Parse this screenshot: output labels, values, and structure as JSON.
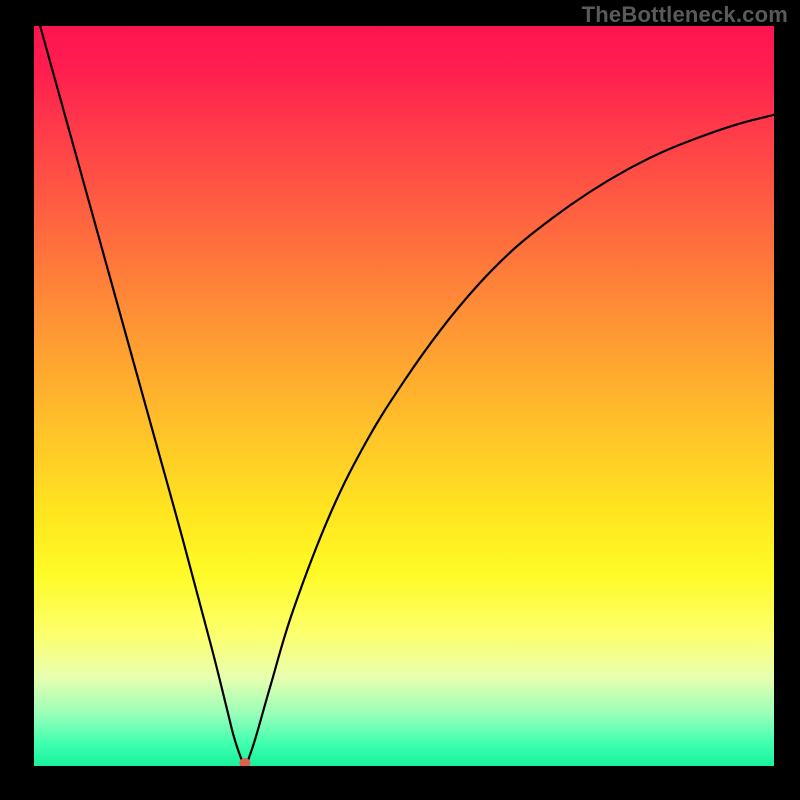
{
  "watermark": "TheBottleneck.com",
  "colors": {
    "frame": "#000000",
    "curve": "#000000",
    "dip_dot": "#e0604f"
  },
  "chart_data": {
    "type": "line",
    "title": "",
    "xlabel": "",
    "ylabel": "",
    "xlim": [
      0,
      100
    ],
    "ylim": [
      0,
      100
    ],
    "grid": false,
    "legend": false,
    "x": [
      0,
      5,
      10,
      15,
      20,
      24,
      26,
      27,
      28,
      28.5,
      29,
      30,
      32,
      35,
      40,
      45,
      50,
      55,
      60,
      65,
      70,
      75,
      80,
      85,
      90,
      95,
      100
    ],
    "y": [
      103,
      85,
      67,
      49,
      31,
      16,
      8,
      4,
      1,
      0,
      1,
      4,
      11,
      21,
      34,
      44,
      52,
      59,
      65,
      70,
      74,
      77.5,
      80.5,
      83,
      85,
      86.7,
      88
    ],
    "annotations": [
      {
        "type": "dot",
        "x": 28.5,
        "y": 0,
        "color": "#e0604f"
      }
    ],
    "background_gradient_stops": [
      {
        "pos": 0.0,
        "color": "#ff1450"
      },
      {
        "pos": 0.28,
        "color": "#ff6a3e"
      },
      {
        "pos": 0.56,
        "color": "#ffc728"
      },
      {
        "pos": 0.82,
        "color": "#fdff6b"
      },
      {
        "pos": 0.97,
        "color": "#3fffb0"
      },
      {
        "pos": 1.0,
        "color": "#18f29a"
      }
    ]
  }
}
